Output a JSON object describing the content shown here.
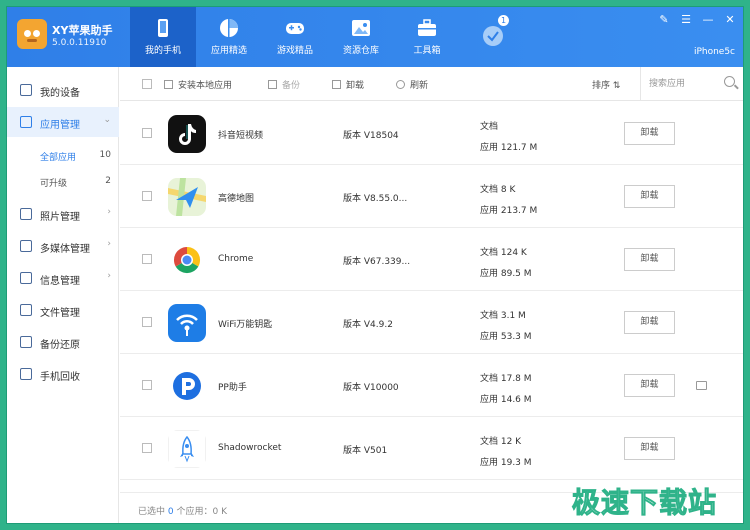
{
  "app": {
    "title": "XY苹果助手",
    "version": "5.0.0.11910",
    "device": "iPhone5c"
  },
  "nav_tabs": [
    {
      "label": "我的手机",
      "icon": "phone-icon",
      "active": true
    },
    {
      "label": "应用精选",
      "icon": "pie-chart-icon",
      "active": false
    },
    {
      "label": "游戏精品",
      "icon": "gamepad-icon",
      "active": false
    },
    {
      "label": "资源仓库",
      "icon": "image-icon",
      "active": false
    },
    {
      "label": "工具箱",
      "icon": "toolbox-icon",
      "active": false
    },
    {
      "label": "",
      "icon": "check-circle-icon",
      "badge": "1",
      "active": false
    }
  ],
  "sidebar": {
    "items": [
      {
        "label": "我的设备",
        "icon": "device-icon"
      },
      {
        "label": "应用管理",
        "icon": "apps-grid-icon",
        "active": true
      },
      {
        "label": "照片管理",
        "icon": "photo-icon"
      },
      {
        "label": "多媒体管理",
        "icon": "media-icon"
      },
      {
        "label": "信息管理",
        "icon": "message-icon"
      },
      {
        "label": "文件管理",
        "icon": "folder-icon"
      },
      {
        "label": "备份还原",
        "icon": "backup-icon"
      },
      {
        "label": "手机回收",
        "icon": "recycle-icon"
      }
    ],
    "sub_items": [
      {
        "label": "全部应用",
        "count": "10",
        "active": true
      },
      {
        "label": "可升级",
        "count": "2"
      }
    ]
  },
  "toolbar": {
    "install_local": "安装本地应用",
    "backup": "备份",
    "uninstall": "卸载",
    "refresh": "刷新",
    "sort": "排序",
    "search_placeholder": "搜索应用"
  },
  "apps": [
    {
      "name": "抖音短视频",
      "version": "版本 V18504",
      "doc": "文档",
      "size": "应用 121.7 M",
      "action": "卸载",
      "icon": "tiktok-icon",
      "color": "#111111"
    },
    {
      "name": "高德地图",
      "version": "版本 V8.55.0...",
      "doc": "文档 8 K",
      "size": "应用 213.7 M",
      "action": "卸载",
      "icon": "amap-icon",
      "color": "#2f8ff0"
    },
    {
      "name": "Chrome",
      "version": "版本 V67.339...",
      "doc": "文档 124 K",
      "size": "应用 89.5 M",
      "action": "卸载",
      "icon": "chrome-icon",
      "color": "#ffffff"
    },
    {
      "name": "WiFi万能钥匙",
      "version": "版本 V4.9.2",
      "doc": "文档 3.1 M",
      "size": "应用 53.3 M",
      "action": "卸载",
      "icon": "wifi-key-icon",
      "color": "#1e7de6"
    },
    {
      "name": "PP助手",
      "version": "版本 V10000",
      "doc": "文档 17.8 M",
      "size": "应用 14.6 M",
      "action": "卸载",
      "icon": "pp-icon",
      "color": "#ffffff"
    },
    {
      "name": "Shadowrocket",
      "version": "版本 V501",
      "doc": "文档 12 K",
      "size": "应用 19.3 M",
      "action": "卸载",
      "icon": "rocket-icon",
      "color": "#ffffff"
    }
  ],
  "status": {
    "prefix": "已选中 ",
    "selected": "0",
    "middle": " 个应用：",
    "size": "0 K"
  },
  "watermark": "极速下载站"
}
